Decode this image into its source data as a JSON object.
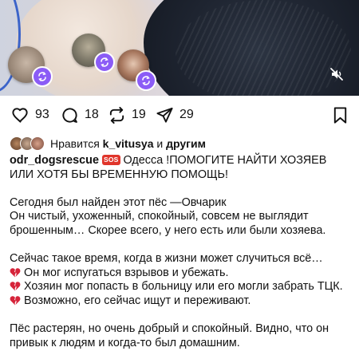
{
  "post": {
    "media": {
      "icons": [
        "remix-icon",
        "mute-icon"
      ]
    },
    "actions": {
      "like_count": "93",
      "comment_count": "18",
      "repost_count": "19",
      "share_count": "29",
      "icons": [
        "heart-icon",
        "comment-icon",
        "repost-icon",
        "share-icon",
        "bookmark-icon"
      ]
    },
    "likes": {
      "prefix": "Нравится",
      "user": "k_vitusya",
      "and": "и",
      "others": "другим"
    },
    "caption": {
      "username": "odr_dogsrescue",
      "sos_badge": "SOS",
      "headline": "Одесса !ПОМОГИТЕ НАЙТИ ХОЗЯЕВ ИЛИ ХОТЯ БЫ ВРЕМЕННУЮ ПОМОЩЬ!",
      "line_1": "Сегодня был найден этот пёс —Овчарик",
      "line_2": "Он чистый, ухоженный, спокойный, совсем не выглядит брошенным… Скорее всего, у него есть или были хозяева.",
      "line_3": "Сейчас такое время, когда в жизни может случиться всё…",
      "bullet_1": "Он мог испугаться взрывов и убежать.",
      "bullet_2": "Хозяин мог попасть в больницу или его могли забрать ТЦК.",
      "bullet_3": "Возможно, его сейчас ищут и переживают.",
      "line_4": "Пёс растерян, но очень добрый и спокойный. Видно, что он привык к людям и когда-то был домашним."
    },
    "colors": {
      "remix_badge": "#8b5cf6",
      "sos_badge": "#e0352b",
      "broken_heart": "#d6243a"
    }
  }
}
